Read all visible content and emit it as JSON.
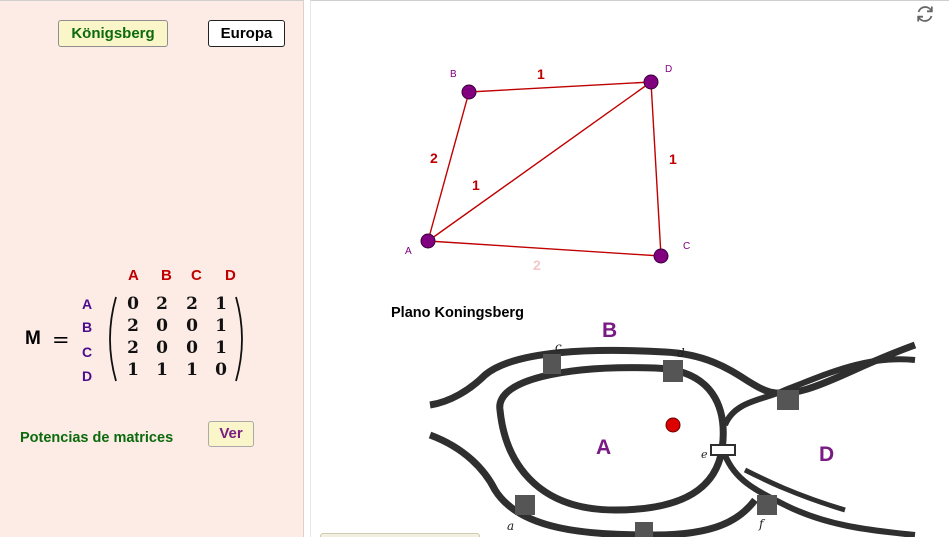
{
  "buttons": {
    "konigsberg": "Königsberg",
    "europa": "Europa",
    "ver": "Ver"
  },
  "matrix": {
    "name": "M",
    "equals": "=",
    "col_labels": [
      "A",
      "B",
      "C",
      "D"
    ],
    "row_labels": [
      "A",
      "B",
      "C",
      "D"
    ],
    "rows": [
      [
        "0",
        "2",
        "2",
        "1"
      ],
      [
        "2",
        "0",
        "0",
        "1"
      ],
      [
        "2",
        "0",
        "0",
        "1"
      ],
      [
        "1",
        "1",
        "1",
        "0"
      ]
    ]
  },
  "potencias_label": "Potencias de matrices",
  "graph": {
    "vertices": [
      {
        "id": "A",
        "label": "A"
      },
      {
        "id": "B",
        "label": "B"
      },
      {
        "id": "C",
        "label": "C"
      },
      {
        "id": "D",
        "label": "D"
      }
    ],
    "edges": [
      {
        "from": "B",
        "to": "D",
        "weight": "1"
      },
      {
        "from": "A",
        "to": "B",
        "weight": "2"
      },
      {
        "from": "A",
        "to": "D",
        "weight": "1"
      },
      {
        "from": "D",
        "to": "C",
        "weight": "1"
      },
      {
        "from": "A",
        "to": "C",
        "weight": "2"
      }
    ],
    "vertex_color": "#800080",
    "edge_color": "#c00000"
  },
  "map": {
    "title": "Plano Koningsberg",
    "region_labels": [
      "B",
      "A",
      "D"
    ],
    "bridge_labels": [
      "c",
      "d",
      "e",
      "a",
      "f"
    ]
  },
  "colors": {
    "left_panel_bg": "#fdebe6",
    "green_text": "#0b6a0b",
    "purple_text": "#7a1a85",
    "red_text": "#c00000"
  }
}
